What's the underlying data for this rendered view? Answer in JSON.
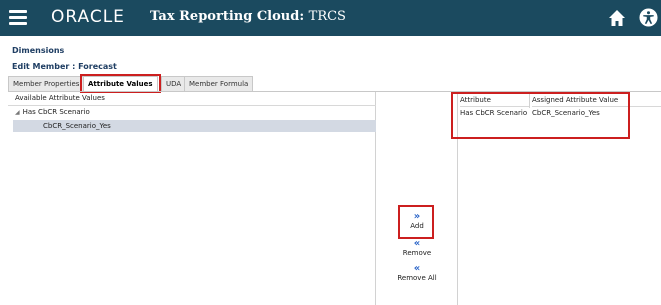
{
  "header": {
    "brand": "ORACLE",
    "app_name": "Tax Reporting Cloud:",
    "app_code": "TRCS",
    "icons": [
      "menu-icon",
      "home-icon",
      "accessibility-icon"
    ]
  },
  "page": {
    "section_title": "Dimensions",
    "edit_title": "Edit Member : Forecast"
  },
  "tabs": [
    {
      "label": "Member Properties",
      "active": false
    },
    {
      "label": "Attribute Values",
      "active": true
    },
    {
      "label": "UDA",
      "active": false
    },
    {
      "label": "Member Formula",
      "active": false
    }
  ],
  "available": {
    "header": "Available Attribute Values",
    "parent": "Has CbCR Scenario",
    "child": "CbCR_Scenario_Yes"
  },
  "actions": {
    "add": "Add",
    "remove": "Remove",
    "remove_all": "Remove All"
  },
  "assigned": {
    "columns": [
      "Attribute",
      "Assigned Attribute Value"
    ],
    "rows": [
      {
        "attribute": "Has CbCR Scenario",
        "value": "CbCR_Scenario_Yes"
      }
    ]
  },
  "colors": {
    "header_bg": "#1b4a5f",
    "highlight_outline": "#cc1f1f",
    "selected_row": "#d3d9e3",
    "action_icon": "#2a64c8"
  }
}
